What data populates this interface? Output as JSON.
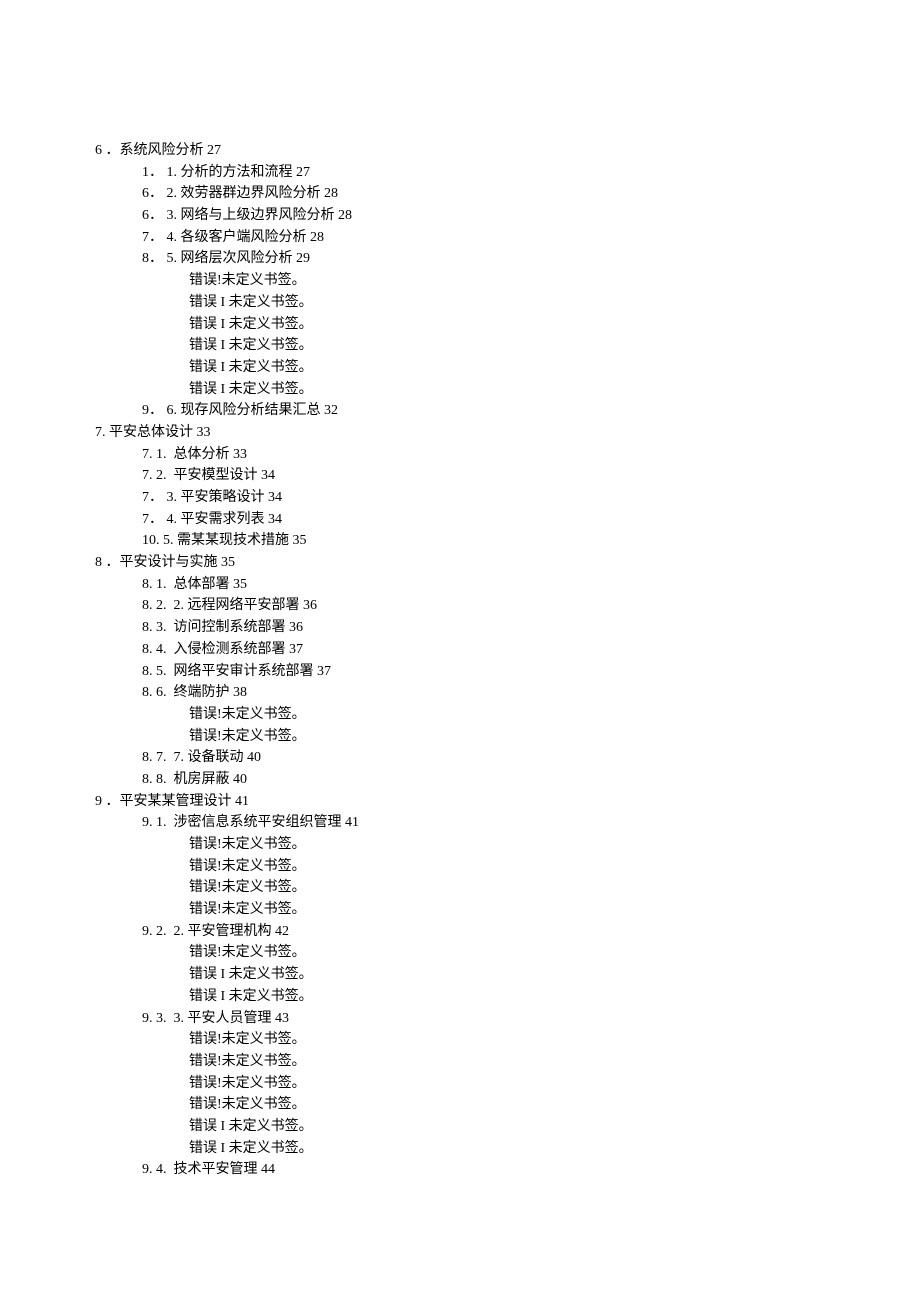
{
  "lines": [
    {
      "indent": 0,
      "text": "6 ．系统风险分析 27"
    },
    {
      "indent": 1,
      "text": "1． 1. 分析的方法和流程 27"
    },
    {
      "indent": 1,
      "text": "6． 2. 效劳器群边界风险分析 28"
    },
    {
      "indent": 1,
      "text": "6． 3. 网络与上级边界风险分析 28"
    },
    {
      "indent": 1,
      "text": "7． 4. 各级客户端风险分析 28"
    },
    {
      "indent": 1,
      "text": "8． 5. 网络层次风险分析 29"
    },
    {
      "indent": 2,
      "text": "错误!未定义书签。"
    },
    {
      "indent": 2,
      "text": "错误 I 未定义书签。"
    },
    {
      "indent": 2,
      "text": "错误 I 未定义书签。"
    },
    {
      "indent": 2,
      "text": "错误 I 未定义书签。"
    },
    {
      "indent": 2,
      "text": "错误 I 未定义书签。"
    },
    {
      "indent": 2,
      "text": "错误 I 未定义书签。"
    },
    {
      "indent": 1,
      "text": "9． 6. 现存风险分析结果汇总 32"
    },
    {
      "indent": 0,
      "text": "7. 平安总体设计 33"
    },
    {
      "indent": 1,
      "text": "7. 1.  总体分析 33"
    },
    {
      "indent": 1,
      "text": "7. 2.  平安模型设计 34"
    },
    {
      "indent": 1,
      "text": "7． 3. 平安策略设计 34"
    },
    {
      "indent": 1,
      "text": "7． 4. 平安需求列表 34"
    },
    {
      "indent": 1,
      "text": "10. 5. 需某某现技术措施 35"
    },
    {
      "indent": 0,
      "text": "8 ．平安设计与实施 35"
    },
    {
      "indent": 1,
      "text": "8. 1.  总体部署 35"
    },
    {
      "indent": 1,
      "text": "8. 2.  2. 远程网络平安部署 36"
    },
    {
      "indent": 1,
      "text": "8. 3.  访问控制系统部署 36"
    },
    {
      "indent": 1,
      "text": "8. 4.  入侵检测系统部署 37"
    },
    {
      "indent": 1,
      "text": "8. 5.  网络平安审计系统部署 37"
    },
    {
      "indent": 1,
      "text": "8. 6.  终端防护 38"
    },
    {
      "indent": 2,
      "text": "错误!未定义书签。"
    },
    {
      "indent": 2,
      "text": "错误!未定义书签。"
    },
    {
      "indent": 1,
      "text": "8. 7.  7. 设备联动 40"
    },
    {
      "indent": 1,
      "text": "8. 8.  机房屏蔽 40"
    },
    {
      "indent": 0,
      "text": "9 ．平安某某管理设计 41"
    },
    {
      "indent": 1,
      "text": "9. 1.  涉密信息系统平安组织管理 41"
    },
    {
      "indent": 2,
      "text": "错误!未定义书签。"
    },
    {
      "indent": 2,
      "text": "错误!未定义书签。"
    },
    {
      "indent": 2,
      "text": "错误!未定义书签。"
    },
    {
      "indent": 2,
      "text": "错误!未定义书签。"
    },
    {
      "indent": 1,
      "text": "9. 2.  2. 平安管理机构 42"
    },
    {
      "indent": 2,
      "text": "错误!未定义书签。"
    },
    {
      "indent": 2,
      "text": "错误 I 未定义书签。"
    },
    {
      "indent": 2,
      "text": "错误 I 未定义书签。"
    },
    {
      "indent": 1,
      "text": "9. 3.  3. 平安人员管理 43"
    },
    {
      "indent": 2,
      "text": "错误!未定义书签。"
    },
    {
      "indent": 2,
      "text": "错误!未定义书签。"
    },
    {
      "indent": 2,
      "text": "错误!未定义书签。"
    },
    {
      "indent": 2,
      "text": "错误!未定义书签。"
    },
    {
      "indent": 2,
      "text": "错误 I 未定义书签。"
    },
    {
      "indent": 2,
      "text": "错误 I 未定义书签。"
    },
    {
      "indent": 1,
      "text": "9. 4.  技术平安管理 44"
    }
  ]
}
